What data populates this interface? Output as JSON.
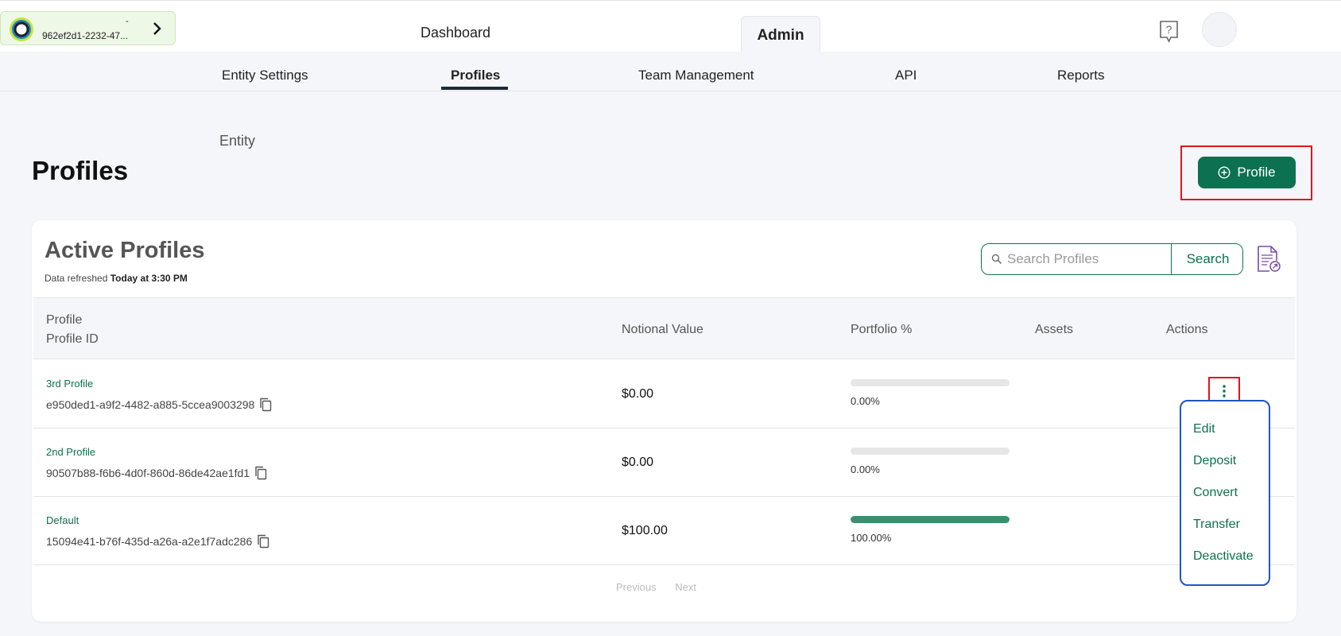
{
  "colors": {
    "brand_green": "#0c7150",
    "progress_fill": "#3b8f70",
    "highlight_red": "#e0141e",
    "menu_border_blue": "#1e55c4"
  },
  "entity_switcher": {
    "dash": "-",
    "id_text": "962ef2d1-2232-47...",
    "icon": "chevron-right-icon"
  },
  "top_nav": {
    "dashboard": "Dashboard",
    "admin": "Admin"
  },
  "sub_nav": {
    "items": [
      "Entity Settings",
      "Profiles",
      "Team Management",
      "API",
      "Reports"
    ],
    "active": "Profiles"
  },
  "page": {
    "entity_label": "Entity",
    "title": "Profiles",
    "add_button": "Profile"
  },
  "card": {
    "title": "Active Profiles",
    "refresh_label": "Data refreshed",
    "refresh_time": "Today at 3:30 PM",
    "search": {
      "placeholder": "Search Profiles",
      "button": "Search"
    }
  },
  "table": {
    "headers": {
      "profile": "Profile",
      "profile_id": "Profile ID",
      "notional": "Notional Value",
      "portfolio": "Portfolio %",
      "assets": "Assets",
      "actions": "Actions"
    },
    "rows": [
      {
        "name": "3rd Profile",
        "id": "e950ded1-a9f2-4482-a885-5ccea9003298",
        "notional": "$0.00",
        "portfolio_pct": "0.00%",
        "portfolio_fraction": 0
      },
      {
        "name": "2nd Profile",
        "id": "90507b88-f6b6-4d0f-860d-86de42ae1fd1",
        "notional": "$0.00",
        "portfolio_pct": "0.00%",
        "portfolio_fraction": 0
      },
      {
        "name": "Default",
        "id": "15094e41-b76f-435d-a26a-a2e1f7adc286",
        "notional": "$100.00",
        "portfolio_pct": "100.00%",
        "portfolio_fraction": 1
      }
    ]
  },
  "pager": {
    "previous": "Previous",
    "next": "Next"
  },
  "action_menu": {
    "items": [
      "Edit",
      "Deposit",
      "Convert",
      "Transfer",
      "Deactivate"
    ]
  }
}
